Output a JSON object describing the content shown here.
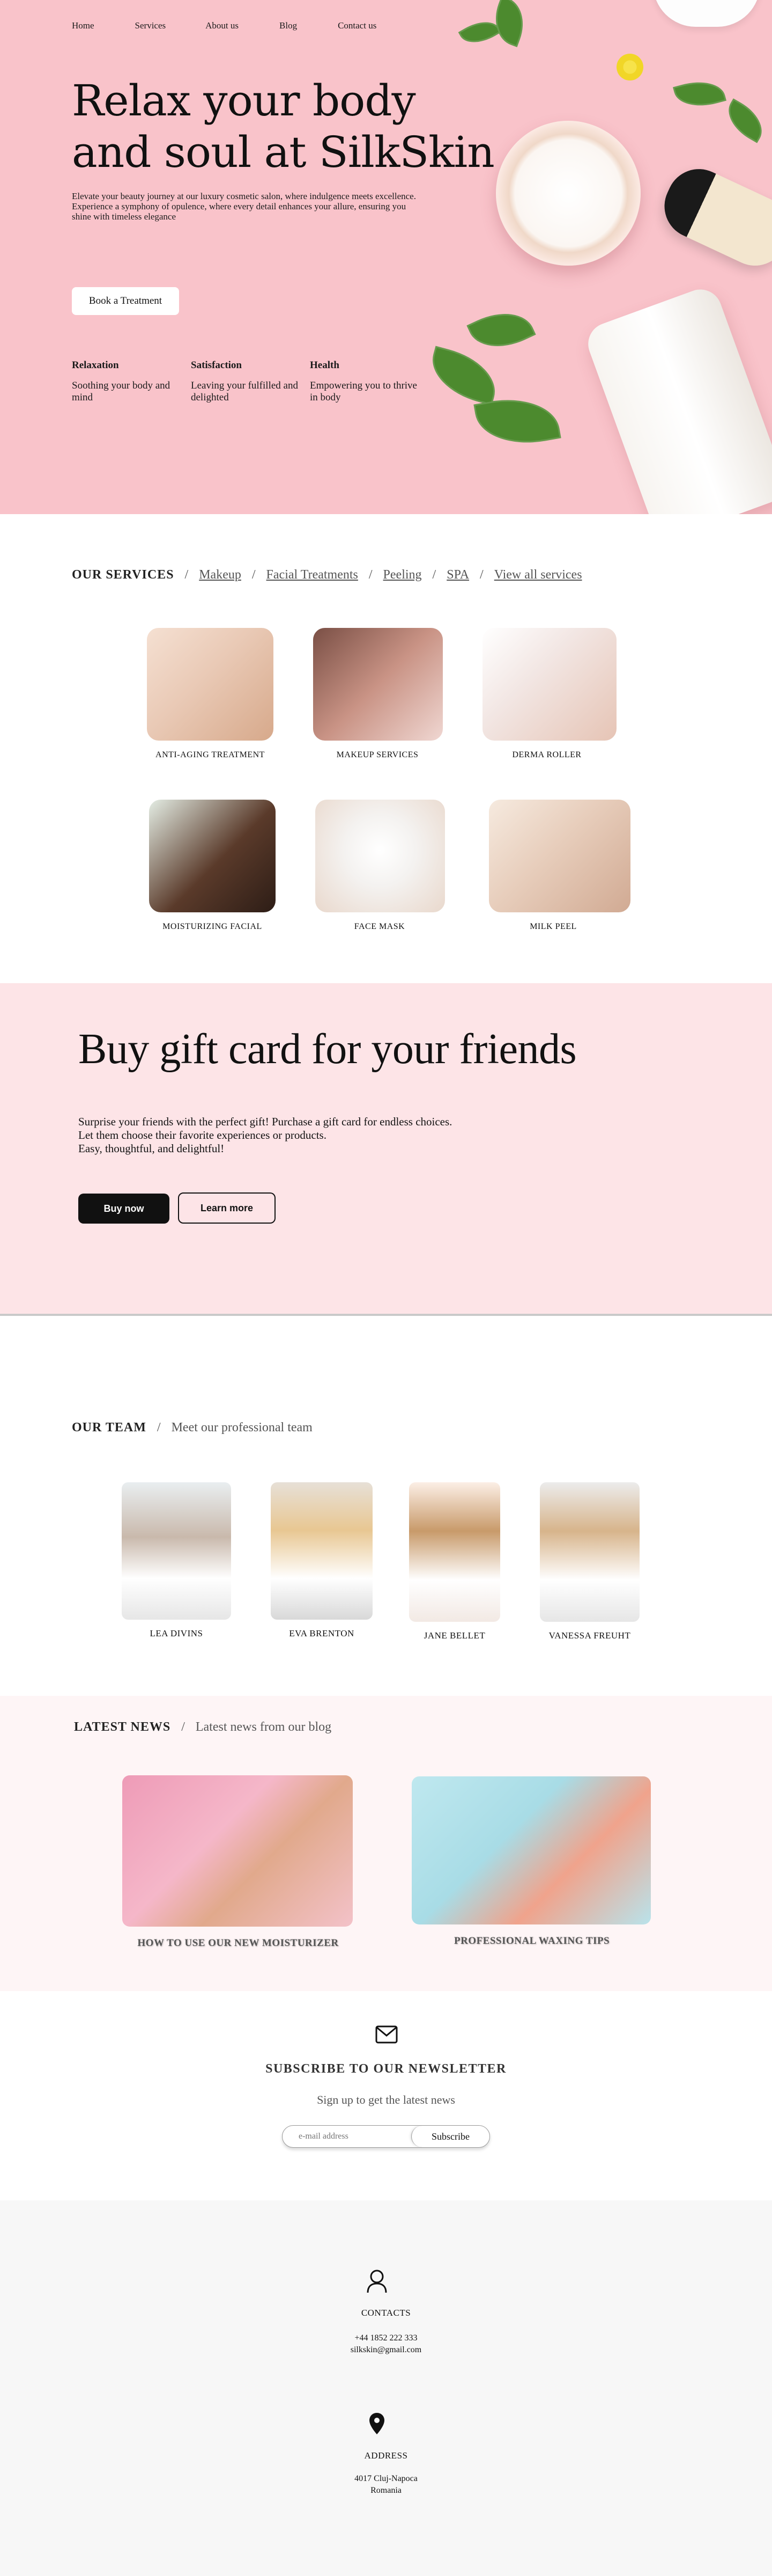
{
  "nav": {
    "items": [
      "Home",
      "Services",
      "About us",
      "Blog",
      "Contact us"
    ]
  },
  "hero": {
    "title_line1": "Relax your body",
    "title_line2": "and soul at SilkSkin",
    "description": "Elevate your beauty journey at our luxury cosmetic salon, where indulgence meets excellence. Experience a symphony of opulence, where every detail enhances your allure, ensuring you shine with timeless elegance",
    "cta_label": "Book a Treatment",
    "features": [
      {
        "title": "Relaxation",
        "text": "Soothing your body and mind"
      },
      {
        "title": "Satisfaction",
        "text": "Leaving your fulfilled and delighted"
      },
      {
        "title": "Health",
        "text": "Empowering you to thrive in body"
      }
    ],
    "background_color": "#f9c3ca"
  },
  "services": {
    "title": "OUR SERVICES",
    "separator": "/",
    "crumbs": [
      "Makeup",
      "Facial Treatments",
      "Peeling",
      "SPA",
      "View all services"
    ],
    "items": [
      {
        "label": "ANTI-AGING TREATMENT"
      },
      {
        "label": "MAKEUP SERVICES"
      },
      {
        "label": "DERMA ROLLER"
      },
      {
        "label": "MOISTURIZING FACIAL"
      },
      {
        "label": "FACE MASK"
      },
      {
        "label": "MILK PEEL"
      }
    ]
  },
  "gift": {
    "title": "Buy gift card for your friends",
    "text_line1": "Surprise your friends with the perfect gift! Purchase a gift card for endless choices. Let them choose their favorite experiences or products.",
    "text_line2": "Easy, thoughtful, and delightful!",
    "buy_label": "Buy now",
    "learn_label": "Learn more",
    "background_color": "#fde4e7"
  },
  "team": {
    "title": "OUR TEAM",
    "separator": "/",
    "subtitle": "Meet our professional team",
    "members": [
      {
        "name": "LEA DIVINS"
      },
      {
        "name": "EVA BRENTON"
      },
      {
        "name": "JANE BELLET"
      },
      {
        "name": "VANESSA FREUHT"
      }
    ]
  },
  "news": {
    "title": "LATEST NEWS",
    "separator": "/",
    "subtitle": "Latest news from our blog",
    "posts": [
      {
        "title": "HOW TO USE OUR NEW MOISTURIZER"
      },
      {
        "title": "PROFESSIONAL WAXING TIPS"
      }
    ]
  },
  "newsletter": {
    "title": "SUBSCRIBE TO OUR NEWSLETTER",
    "subtitle": "Sign up to get the latest news",
    "placeholder": "e-mail address",
    "button_label": "Subscribe",
    "icon": "mail-icon"
  },
  "footer": {
    "contacts_label": "CONTACTS",
    "phone": "+44 1852 222 333",
    "email": "silkskin@gmail.com",
    "address_label": "ADDRESS",
    "address_line1": "4017 Cluj-Napoca",
    "address_line2": "Romania",
    "contacts_icon": "user-icon",
    "address_icon": "location-pin-icon"
  }
}
